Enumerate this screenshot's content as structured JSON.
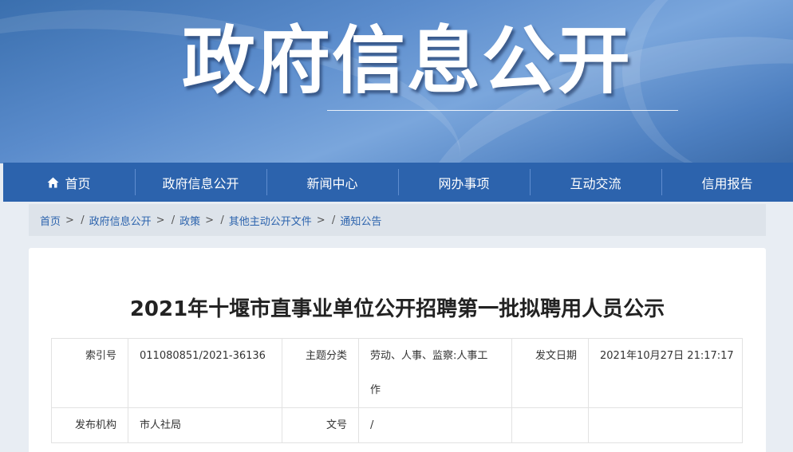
{
  "banner": {
    "title": "政府信息公开"
  },
  "nav": {
    "items": [
      {
        "label": "首页",
        "icon": "home-icon"
      },
      {
        "label": "政府信息公开"
      },
      {
        "label": "新闻中心"
      },
      {
        "label": "网办事项"
      },
      {
        "label": "互动交流"
      },
      {
        "label": "信用报告"
      }
    ]
  },
  "breadcrumb": {
    "items": [
      "首页",
      "政府信息公开",
      "政策",
      "其他主动公开文件",
      "通知公告"
    ],
    "separator": ">",
    "divider": "/"
  },
  "article": {
    "title": "2021年十堰市直事业单位公开招聘第一批拟聘用人员公示",
    "meta": {
      "index_label": "索引号",
      "index_value": "011080851/2021-36136",
      "topic_label": "主题分类",
      "topic_value_line1": "劳动、人事、监察:人事工",
      "topic_value_line2": "作",
      "date_label": "发文日期",
      "date_value": "2021年10月27日 21:17:17",
      "publisher_label": "发布机构",
      "publisher_value": "市人社局",
      "docno_label": "文号",
      "docno_value": "/"
    }
  },
  "colors": {
    "nav_bg": "#2c63ad",
    "link": "#2c63ad",
    "breadcrumb_bg": "#dde3ea"
  }
}
